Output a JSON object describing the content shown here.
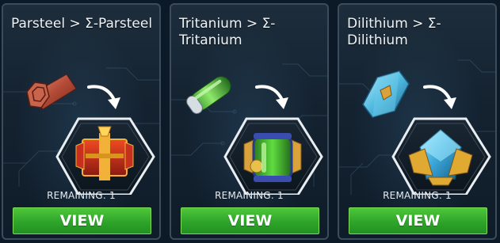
{
  "cards": [
    {
      "title": "Parsteel > Σ-Parsteel",
      "source_icon": "parsteel-hex-bar-icon",
      "target_icon": "sigma-parsteel-crate-icon",
      "remaining_label": "REMAINING: 1",
      "button_label": "VIEW",
      "accent_color": "#c43a22"
    },
    {
      "title": "Tritanium > Σ-Tritanium",
      "source_icon": "tritanium-capsule-icon",
      "target_icon": "sigma-tritanium-canister-icon",
      "remaining_label": "REMAINING: 1",
      "button_label": "VIEW",
      "accent_color": "#3ec23a"
    },
    {
      "title": "Dilithium > Σ-Dilithium",
      "source_icon": "dilithium-crystal-icon",
      "target_icon": "sigma-dilithium-crystal-icon",
      "remaining_label": "REMAINING: 1",
      "button_label": "VIEW",
      "accent_color": "#4fc4e8"
    }
  ],
  "colors": {
    "button_green": "#2ea52a",
    "card_border": "#3b4c5c",
    "background": "#0b1a26"
  }
}
